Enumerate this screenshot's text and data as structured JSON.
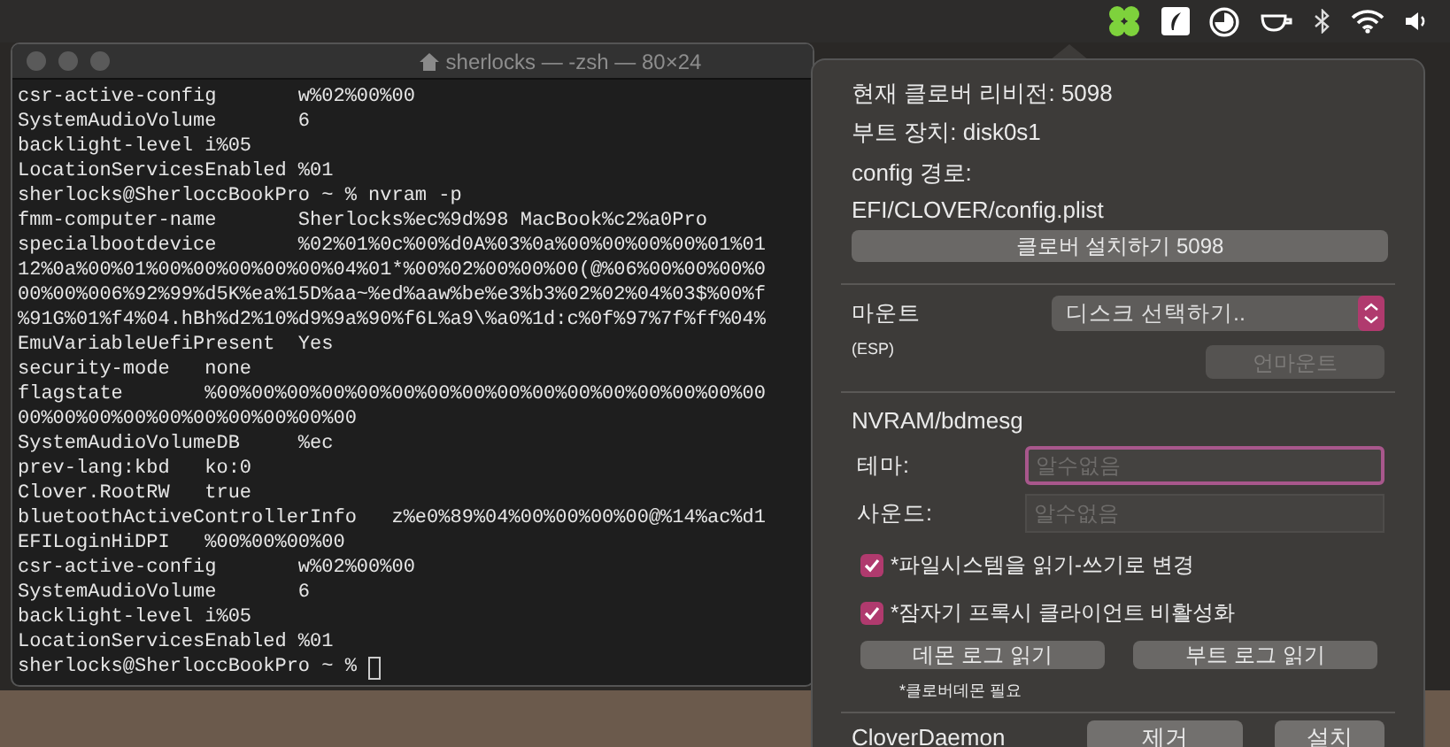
{
  "menu_bar": {
    "icons": [
      {
        "kind": "clover",
        "selected": true
      },
      {
        "kind": "feather"
      },
      {
        "kind": "clock"
      },
      {
        "kind": "cup"
      },
      {
        "kind": "bluetooth"
      },
      {
        "kind": "wifi"
      },
      {
        "kind": "volume"
      }
    ]
  },
  "terminal": {
    "title": "sherlocks — -zsh — 80×24",
    "lines": [
      "csr-active-config       w%02%00%00",
      "SystemAudioVolume       6",
      "backlight-level i%05",
      "LocationServicesEnabled %01",
      "sherlocks@SherloccBookPro ~ % nvram -p",
      "fmm-computer-name       Sherlocks%ec%9d%98 MacBook%c2%a0Pro",
      "specialbootdevice       %02%01%0c%00%d0A%03%0a%00%00%00%00%01%01",
      "12%0a%00%01%00%00%00%00%00%04%01*%00%02%00%00%00(@%06%00%00%00%0",
      "00%00%006%92%99%d5K%ea%15D%aa~%ed%aaw%be%e3%b3%02%02%04%03$%00%f",
      "%91G%01%f4%04.hBh%d2%10%d9%9a%90%f6L%a9\\%a0%1d:c%0f%97%7f%ff%04%",
      "EmuVariableUefiPresent  Yes",
      "security-mode   none",
      "flagstate       %00%00%00%00%00%00%00%00%00%00%00%00%00%00%00%00",
      "00%00%00%00%00%00%00%00%00%00",
      "SystemAudioVolumeDB     %ec",
      "prev-lang:kbd   ko:0",
      "Clover.RootRW   true",
      "bluetoothActiveControllerInfo   z%e0%89%04%00%00%00%00@%14%ac%d1",
      "EFILoginHiDPI   %00%00%00%00",
      "csr-active-config       w%02%00%00",
      "SystemAudioVolume       6",
      "backlight-level i%05",
      "LocationServicesEnabled %01",
      "sherlocks@SherloccBookPro ~ % "
    ]
  },
  "popover": {
    "revision": "현재 클로버 리비전: 5098",
    "boot_device": "부트 장치: disk0s1",
    "config_label": "config 경로:",
    "config_path": "EFI/CLOVER/config.plist",
    "install_button": "클로버 설치하기 5098",
    "mount": {
      "label": "마운트",
      "sublabel": "(ESP)",
      "select_value": "디스크 선택하기..",
      "unmount_button": {
        "label": "언마운트",
        "disabled": true
      }
    },
    "nvram": {
      "heading": "NVRAM/bdmesg",
      "fields": [
        {
          "label": "테마:",
          "placeholder": "알수없음",
          "focused": true
        },
        {
          "label": "사운드:",
          "placeholder": "알수없음",
          "focused": false
        }
      ],
      "checkboxes": [
        {
          "label": "*파일시스템을 읽기-쓰기로 변경",
          "checked": true
        },
        {
          "label": "*잠자기 프록시 클라이언트 비활성화",
          "checked": true
        }
      ],
      "buttons": [
        "데몬 로그 읽기",
        "부트 로그 읽기"
      ],
      "note": "*클로버데몬 필요"
    },
    "daemon": {
      "label": "CloverDaemon",
      "buttons": [
        "제거",
        "설치"
      ]
    }
  }
}
